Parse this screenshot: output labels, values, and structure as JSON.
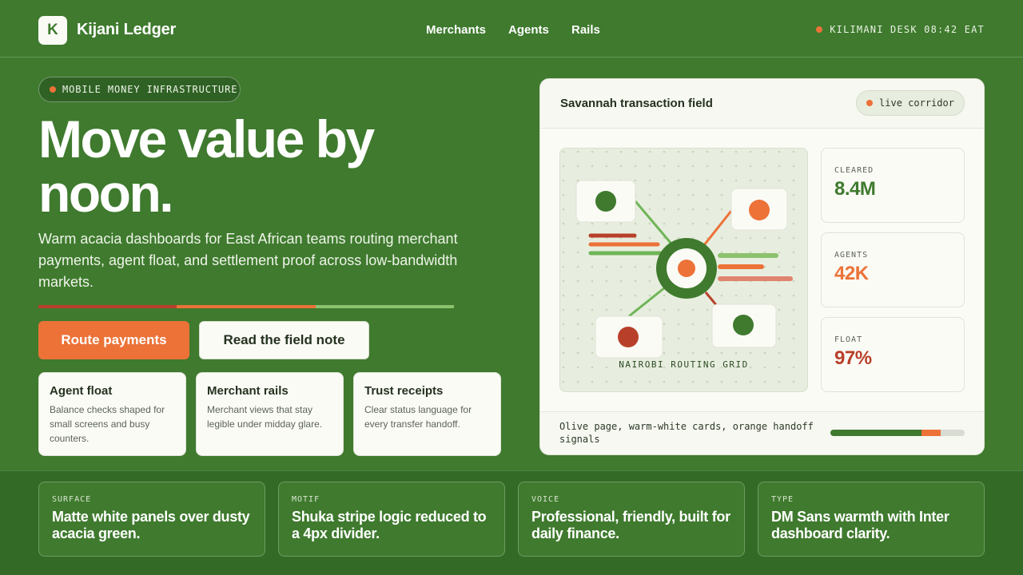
{
  "header": {
    "logo_letter": "K",
    "brand": "Kijani Ledger",
    "nav": [
      "Merchants",
      "Agents",
      "Rails"
    ],
    "desk_status": "KILIMANI DESK 08:42 EAT"
  },
  "hero": {
    "pill": "MOBILE MONEY INFRASTRUCTURE",
    "headline": "Move value by noon.",
    "lede": "Warm acacia dashboards for East African teams routing merchant payments, agent float, and settlement proof across low-bandwidth markets.",
    "primary_button": "Route payments",
    "secondary_button": "Read the field note",
    "cards": [
      {
        "title": "Agent float",
        "body": "Balance checks shaped for small screens and busy counters."
      },
      {
        "title": "Merchant rails",
        "body": "Merchant views that stay legible under midday glare."
      },
      {
        "title": "Trust receipts",
        "body": "Clear status language for every transfer handoff."
      }
    ]
  },
  "panel": {
    "title": "Savannah transaction field",
    "live_badge": "live corridor",
    "grid_label": "NAIROBI ROUTING GRID",
    "stats": [
      {
        "label": "CLEARED",
        "value": "8.4M",
        "color": "#3f7a2e"
      },
      {
        "label": "AGENTS",
        "value": "42K",
        "color": "#ec7238"
      },
      {
        "label": "FLOAT",
        "value": "97%",
        "color": "#b8402a"
      }
    ],
    "footer_text": "Olive page, warm-white cards, orange handoff signals"
  },
  "bottom": [
    {
      "kicker": "SURFACE",
      "text": "Matte white panels over dusty acacia green."
    },
    {
      "kicker": "MOTIF",
      "text": "Shuka stripe logic reduced to a 4px divider."
    },
    {
      "kicker": "VOICE",
      "text": "Professional, friendly, built for daily finance."
    },
    {
      "kicker": "TYPE",
      "text": "DM Sans warmth with Inter dashboard clarity."
    }
  ],
  "colors": {
    "page": "#3f7a2e",
    "accent": "#ec7238",
    "red": "#b8402a",
    "card": "#fbfbf6"
  }
}
